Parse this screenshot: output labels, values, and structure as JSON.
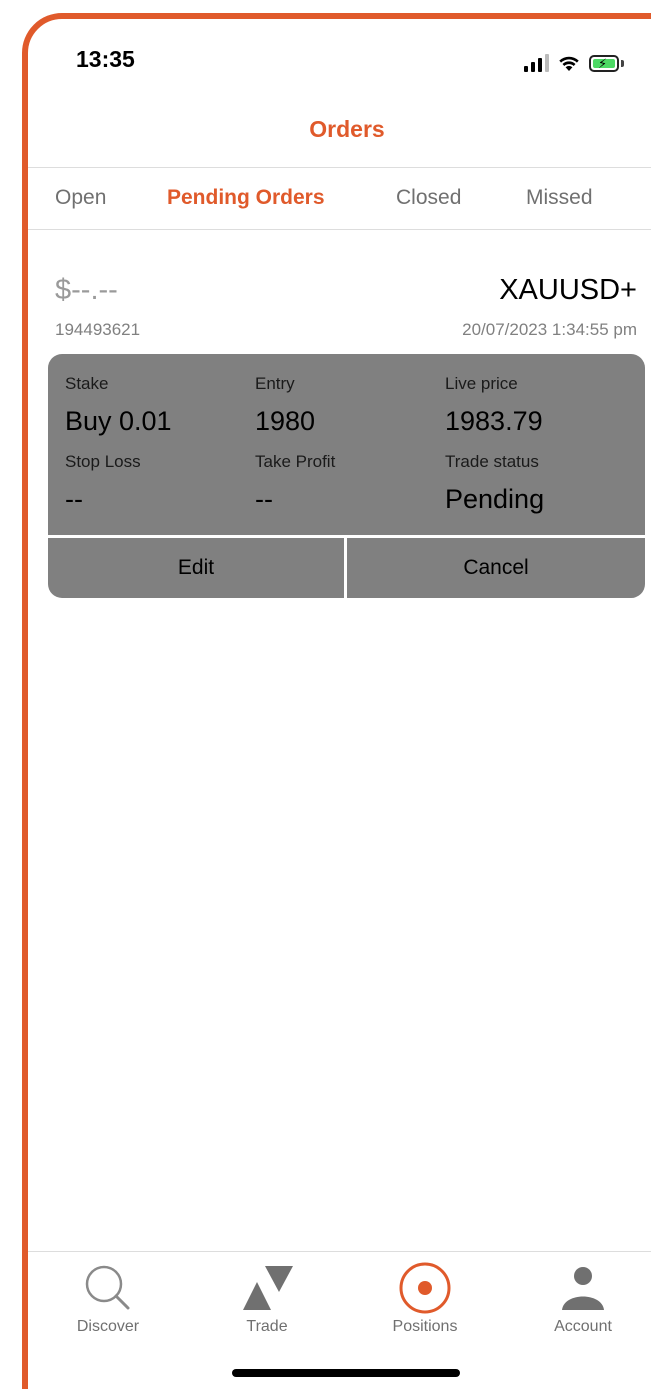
{
  "status_bar": {
    "time": "13:35"
  },
  "header": {
    "title": "Orders"
  },
  "tabs": [
    {
      "label": "Open",
      "active": false
    },
    {
      "label": "Pending Orders",
      "active": true
    },
    {
      "label": "Closed",
      "active": false
    },
    {
      "label": "Missed",
      "active": false
    }
  ],
  "order": {
    "amount": "$--.--",
    "symbol": "XAUUSD+",
    "id": "194493621",
    "datetime": "20/07/2023 1:34:55 pm",
    "fields": {
      "stake": {
        "label": "Stake",
        "value": "Buy 0.01"
      },
      "entry": {
        "label": "Entry",
        "value": "1980"
      },
      "live_price": {
        "label": "Live price",
        "value": "1983.79"
      },
      "stop_loss": {
        "label": "Stop Loss",
        "value": "--"
      },
      "take_profit": {
        "label": "Take Profit",
        "value": "--"
      },
      "trade_status": {
        "label": "Trade status",
        "value": "Pending"
      }
    },
    "actions": {
      "edit": "Edit",
      "cancel": "Cancel"
    }
  },
  "bottom_nav": [
    {
      "label": "Discover",
      "icon": "search-icon",
      "active": false
    },
    {
      "label": "Trade",
      "icon": "trade-icon",
      "active": false
    },
    {
      "label": "Positions",
      "icon": "positions-icon",
      "active": true
    },
    {
      "label": "Account",
      "icon": "user-icon",
      "active": false
    }
  ],
  "colors": {
    "accent": "#e05a2b",
    "card": "#808080",
    "inactive_text": "#707070"
  }
}
